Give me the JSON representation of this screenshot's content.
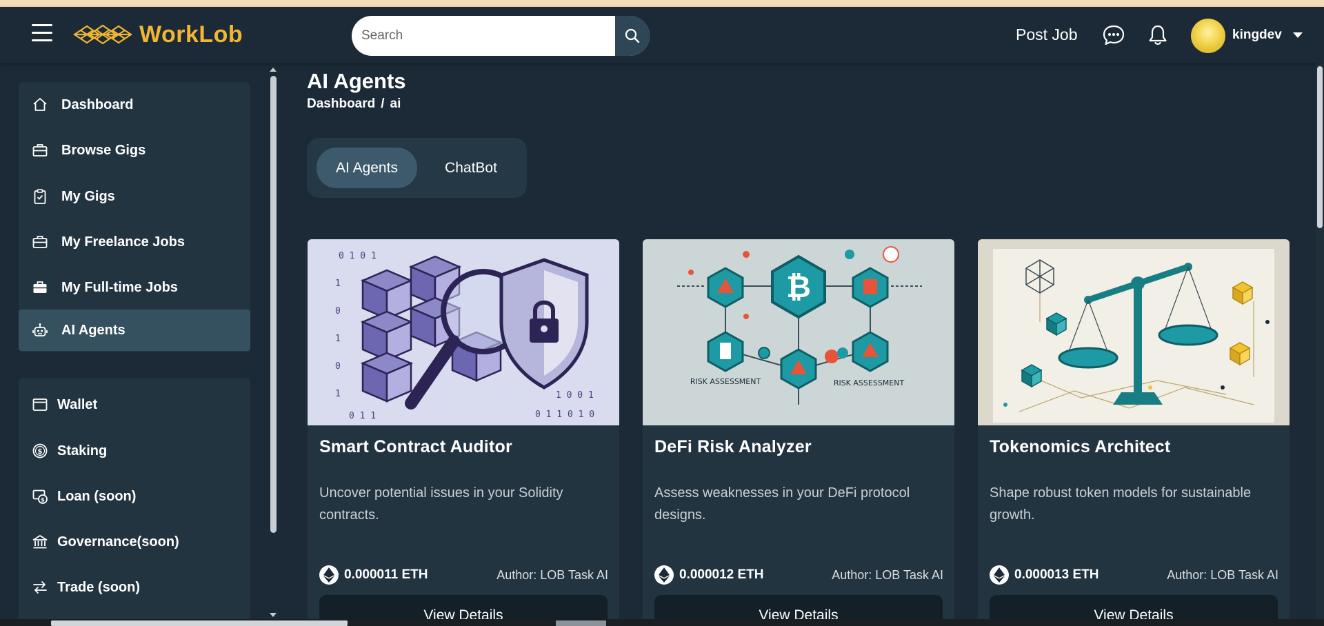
{
  "brand": {
    "name": "WorkLob",
    "accent": "#f2b632"
  },
  "search": {
    "placeholder": "Search"
  },
  "header": {
    "post_job": "Post Job",
    "username": "kingdev"
  },
  "sidebar": {
    "main_items": [
      {
        "label": "Dashboard",
        "icon": "home-icon"
      },
      {
        "label": "Browse Gigs",
        "icon": "briefcase-icon"
      },
      {
        "label": "My Gigs",
        "icon": "clipboard-icon"
      },
      {
        "label": "My Freelance Jobs",
        "icon": "briefcase-icon"
      },
      {
        "label": "My Full-time Jobs",
        "icon": "briefcase-filled-icon"
      },
      {
        "label": "AI Agents",
        "icon": "robot-icon",
        "active": true
      }
    ],
    "finance_items": [
      {
        "label": "Wallet",
        "icon": "wallet-icon"
      },
      {
        "label": "Staking",
        "icon": "coin-icon"
      },
      {
        "label": "Loan (soon)",
        "icon": "loan-icon"
      },
      {
        "label": "Governance(soon)",
        "icon": "bank-icon"
      },
      {
        "label": "Trade (soon)",
        "icon": "arrows-swap-icon"
      }
    ]
  },
  "page": {
    "title": "AI Agents",
    "breadcrumb": [
      "Dashboard",
      "/",
      "ai"
    ],
    "tabs": [
      {
        "label": "AI Agents",
        "active": true
      },
      {
        "label": "ChatBot",
        "active": false
      }
    ]
  },
  "cards": [
    {
      "title": "Smart Contract Auditor",
      "description": "Uncover potential issues in your Solidity contracts.",
      "price": "0.000011 ETH",
      "author": "Author: LOB Task AI",
      "button": "View Details"
    },
    {
      "title": "DeFi Risk Analyzer",
      "description": "Assess weaknesses in your DeFi protocol designs.",
      "price": "0.000012 ETH",
      "author": "Author: LOB Task AI",
      "button": "View Details",
      "image_text": {
        "left": "RISK ASSESSMENT",
        "right": "RISK ASSESSMENT"
      }
    },
    {
      "title": "Tokenomics Architect",
      "description": "Shape robust token models for sustainable growth.",
      "price": "0.000013 ETH",
      "author": "Author: LOB Task AI",
      "button": "View Details"
    }
  ]
}
